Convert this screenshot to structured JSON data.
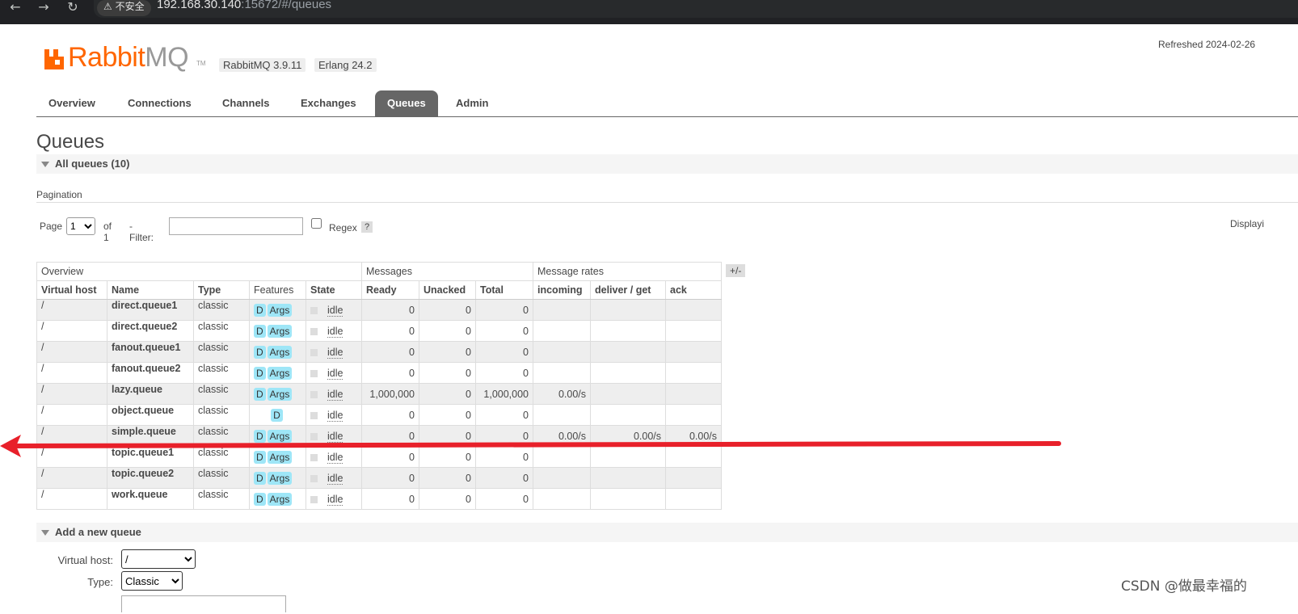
{
  "browser": {
    "security_label": "⚠ 不安全",
    "url_host": "192.168.30.140",
    "url_rest": ":15672/#/queues"
  },
  "header": {
    "logo_rabbit": "Rabbit",
    "logo_mq": "MQ",
    "logo_tm": "TM",
    "version_rabbit": "RabbitMQ 3.9.11",
    "version_erlang": "Erlang 24.2",
    "refreshed": "Refreshed 2024-02-26"
  },
  "tabs": [
    {
      "label": "Overview",
      "active": false
    },
    {
      "label": "Connections",
      "active": false
    },
    {
      "label": "Channels",
      "active": false
    },
    {
      "label": "Exchanges",
      "active": false
    },
    {
      "label": "Queues",
      "active": true
    },
    {
      "label": "Admin",
      "active": false
    }
  ],
  "page": {
    "title": "Queues",
    "all_queues": "All queues (10)",
    "pagination_label": "Pagination",
    "page_label": "Page",
    "page_value": "1",
    "of_label": "of 1",
    "filter_label": "- Filter:",
    "filter_value": "",
    "regex_label": "Regex",
    "help": "?",
    "displaying": "Displayi",
    "plus_minus": "+/-"
  },
  "table": {
    "groups": [
      "Overview",
      "Messages",
      "Message rates"
    ],
    "columns": [
      "Virtual host",
      "Name",
      "Type",
      "Features",
      "State",
      "Ready",
      "Unacked",
      "Total",
      "incoming",
      "deliver / get",
      "ack"
    ],
    "rows": [
      {
        "vhost": "/",
        "name": "direct.queue1",
        "type": "classic",
        "features": [
          "D",
          "Args"
        ],
        "state": "idle",
        "ready": "0",
        "unacked": "0",
        "total": "0",
        "incoming": "",
        "deliver": "",
        "ack": ""
      },
      {
        "vhost": "/",
        "name": "direct.queue2",
        "type": "classic",
        "features": [
          "D",
          "Args"
        ],
        "state": "idle",
        "ready": "0",
        "unacked": "0",
        "total": "0",
        "incoming": "",
        "deliver": "",
        "ack": ""
      },
      {
        "vhost": "/",
        "name": "fanout.queue1",
        "type": "classic",
        "features": [
          "D",
          "Args"
        ],
        "state": "idle",
        "ready": "0",
        "unacked": "0",
        "total": "0",
        "incoming": "",
        "deliver": "",
        "ack": ""
      },
      {
        "vhost": "/",
        "name": "fanout.queue2",
        "type": "classic",
        "features": [
          "D",
          "Args"
        ],
        "state": "idle",
        "ready": "0",
        "unacked": "0",
        "total": "0",
        "incoming": "",
        "deliver": "",
        "ack": ""
      },
      {
        "vhost": "/",
        "name": "lazy.queue",
        "type": "classic",
        "features": [
          "D",
          "Args"
        ],
        "state": "idle",
        "ready": "1,000,000",
        "unacked": "0",
        "total": "1,000,000",
        "incoming": "0.00/s",
        "deliver": "",
        "ack": ""
      },
      {
        "vhost": "/",
        "name": "object.queue",
        "type": "classic",
        "features": [
          "D"
        ],
        "state": "idle",
        "ready": "0",
        "unacked": "0",
        "total": "0",
        "incoming": "",
        "deliver": "",
        "ack": ""
      },
      {
        "vhost": "/",
        "name": "simple.queue",
        "type": "classic",
        "features": [
          "D",
          "Args"
        ],
        "state": "idle",
        "ready": "0",
        "unacked": "0",
        "total": "0",
        "incoming": "0.00/s",
        "deliver": "0.00/s",
        "ack": "0.00/s"
      },
      {
        "vhost": "/",
        "name": "topic.queue1",
        "type": "classic",
        "features": [
          "D",
          "Args"
        ],
        "state": "idle",
        "ready": "0",
        "unacked": "0",
        "total": "0",
        "incoming": "",
        "deliver": "",
        "ack": ""
      },
      {
        "vhost": "/",
        "name": "topic.queue2",
        "type": "classic",
        "features": [
          "D",
          "Args"
        ],
        "state": "idle",
        "ready": "0",
        "unacked": "0",
        "total": "0",
        "incoming": "",
        "deliver": "",
        "ack": ""
      },
      {
        "vhost": "/",
        "name": "work.queue",
        "type": "classic",
        "features": [
          "D",
          "Args"
        ],
        "state": "idle",
        "ready": "0",
        "unacked": "0",
        "total": "0",
        "incoming": "",
        "deliver": "",
        "ack": ""
      }
    ]
  },
  "add_queue": {
    "title": "Add a new queue",
    "vhost_label": "Virtual host:",
    "vhost_value": "/",
    "type_label": "Type:",
    "type_value": "Classic"
  },
  "watermark": "CSDN @做最幸福的",
  "colors": {
    "brand_orange": "#ff6600",
    "active_tab": "#666666",
    "feature_badge": "#9ee6f7",
    "annotation_arrow": "#e8202a"
  }
}
